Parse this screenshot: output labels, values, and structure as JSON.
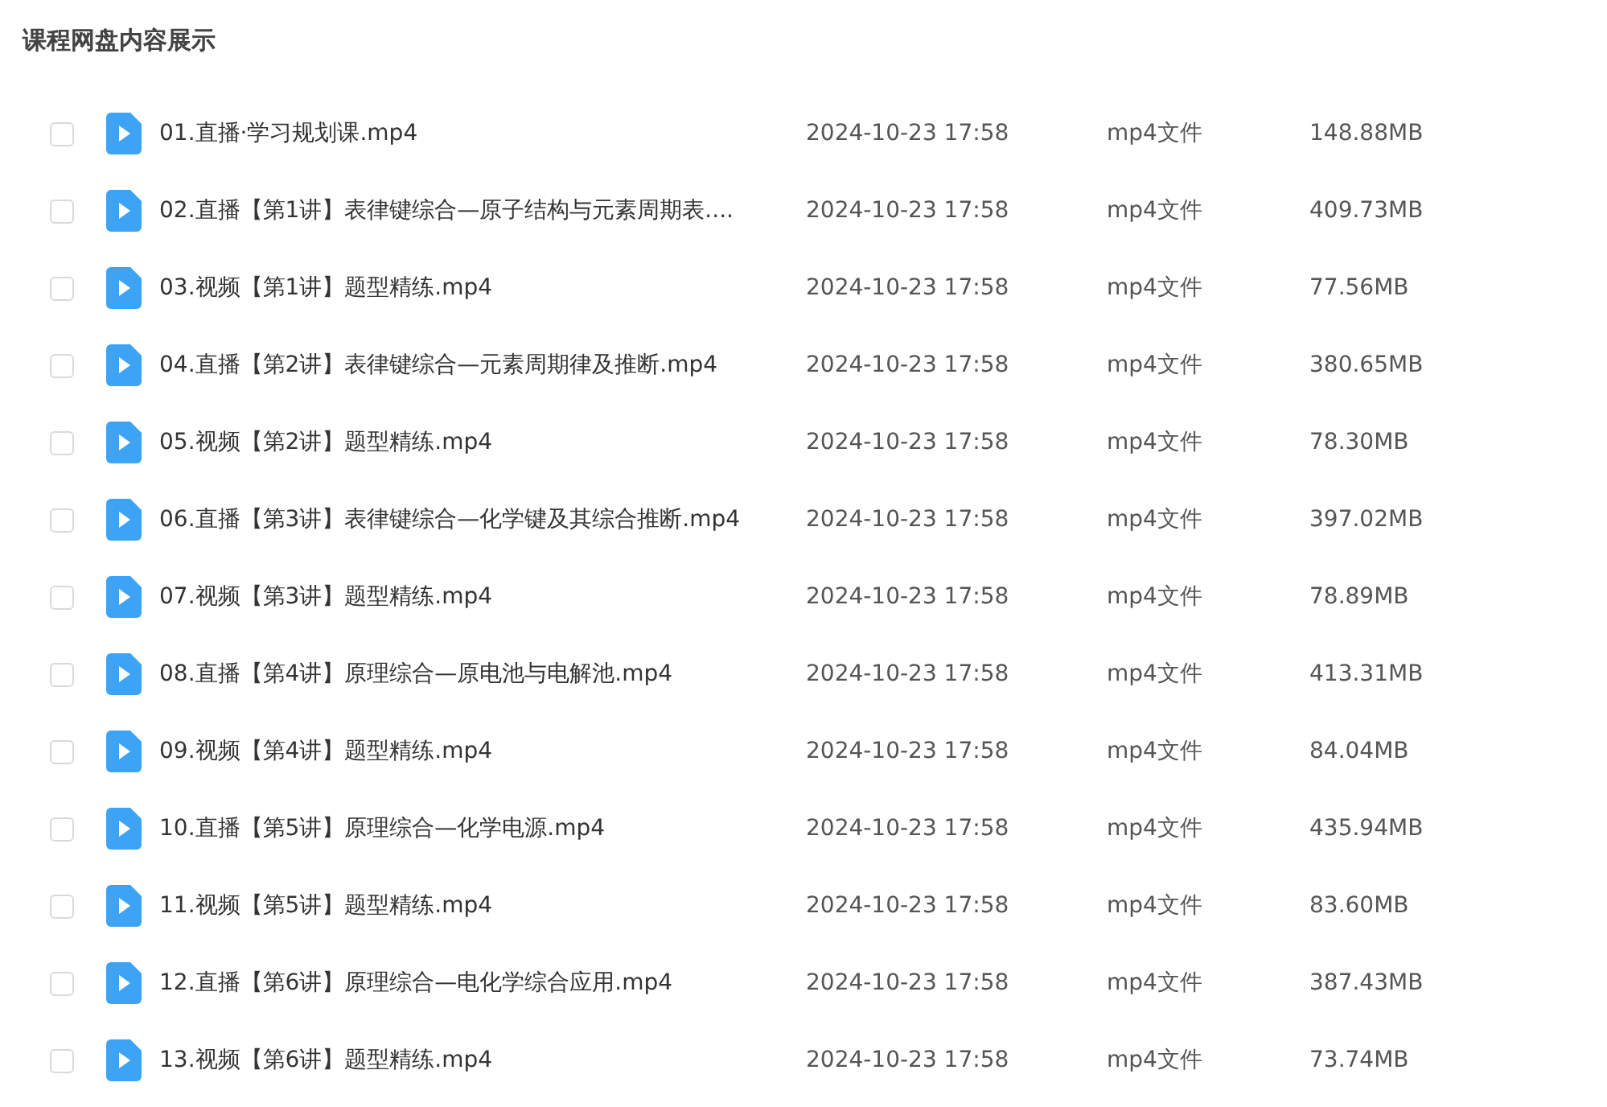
{
  "title": "课程网盘内容展示",
  "files": [
    {
      "name": "01.直播·学习规划课.mp4",
      "date": "2024-10-23 17:58",
      "type": "mp4文件",
      "size": "148.88MB",
      "checked": false
    },
    {
      "name": "02.直播【第1讲】表律键综合—原子结构与元素周期表....",
      "date": "2024-10-23 17:58",
      "type": "mp4文件",
      "size": "409.73MB",
      "checked": false
    },
    {
      "name": "03.视频【第1讲】题型精练.mp4",
      "date": "2024-10-23 17:58",
      "type": "mp4文件",
      "size": "77.56MB",
      "checked": false
    },
    {
      "name": "04.直播【第2讲】表律键综合—元素周期律及推断.mp4",
      "date": "2024-10-23 17:58",
      "type": "mp4文件",
      "size": "380.65MB",
      "checked": false
    },
    {
      "name": "05.视频【第2讲】题型精练.mp4",
      "date": "2024-10-23 17:58",
      "type": "mp4文件",
      "size": "78.30MB",
      "checked": false
    },
    {
      "name": "06.直播【第3讲】表律键综合—化学键及其综合推断.mp4",
      "date": "2024-10-23 17:58",
      "type": "mp4文件",
      "size": "397.02MB",
      "checked": false
    },
    {
      "name": "07.视频【第3讲】题型精练.mp4",
      "date": "2024-10-23 17:58",
      "type": "mp4文件",
      "size": "78.89MB",
      "checked": false
    },
    {
      "name": "08.直播【第4讲】原理综合—原电池与电解池.mp4",
      "date": "2024-10-23 17:58",
      "type": "mp4文件",
      "size": "413.31MB",
      "checked": false
    },
    {
      "name": "09.视频【第4讲】题型精练.mp4",
      "date": "2024-10-23 17:58",
      "type": "mp4文件",
      "size": "84.04MB",
      "checked": false
    },
    {
      "name": "10.直播【第5讲】原理综合—化学电源.mp4",
      "date": "2024-10-23 17:58",
      "type": "mp4文件",
      "size": "435.94MB",
      "checked": false
    },
    {
      "name": "11.视频【第5讲】题型精练.mp4",
      "date": "2024-10-23 17:58",
      "type": "mp4文件",
      "size": "83.60MB",
      "checked": false
    },
    {
      "name": "12.直播【第6讲】原理综合—电化学综合应用.mp4",
      "date": "2024-10-23 17:58",
      "type": "mp4文件",
      "size": "387.43MB",
      "checked": false
    },
    {
      "name": "13.视频【第6讲】题型精练.mp4",
      "date": "2024-10-23 17:58",
      "type": "mp4文件",
      "size": "73.74MB",
      "checked": false
    }
  ]
}
